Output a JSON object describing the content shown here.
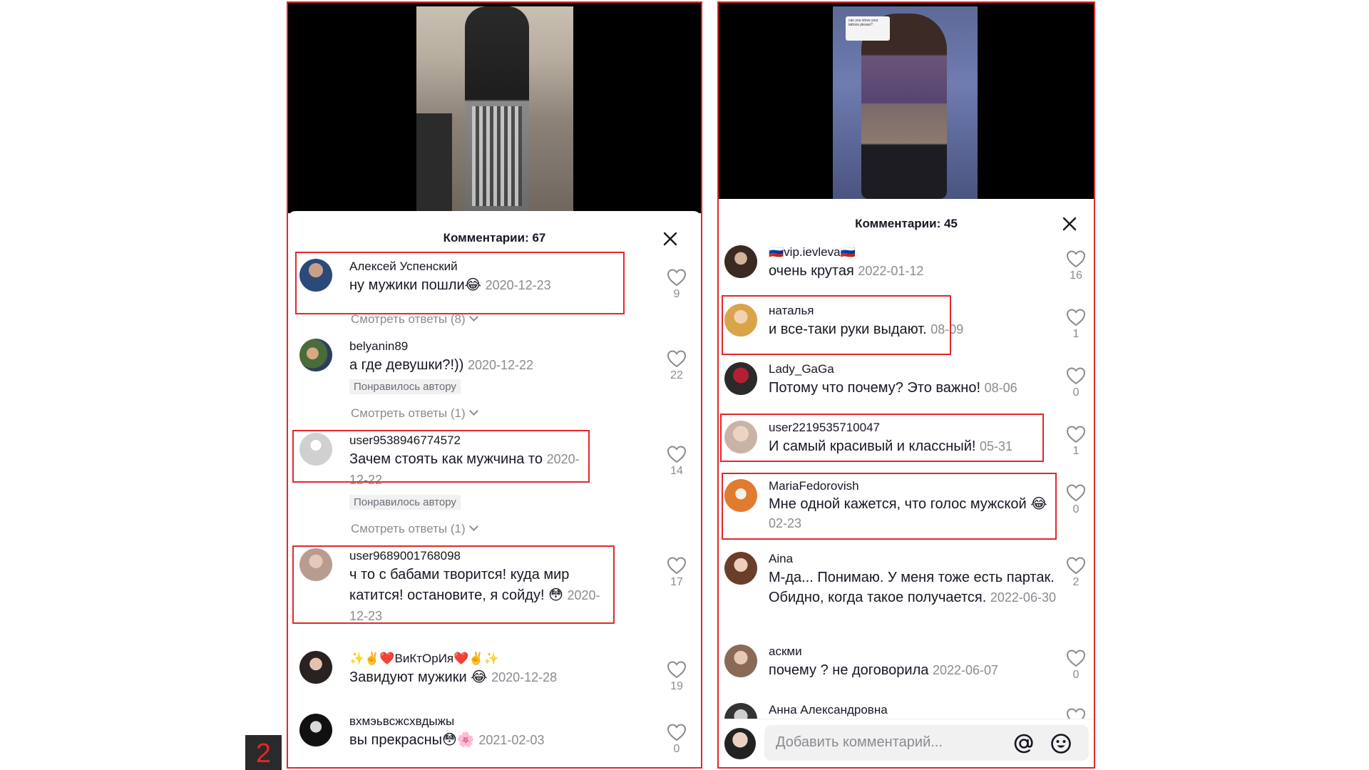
{
  "left": {
    "title": "Комментарии: 67",
    "comments": [
      {
        "user": "Алексей Успенский",
        "text": "ну мужики пошли😂",
        "date": "2020-12-23",
        "likes": "9",
        "replies": "Смотреть ответы (8)"
      },
      {
        "user": "belyanin89",
        "text": "а где девушки?!))",
        "date": "2020-12-22",
        "likes": "22",
        "liked": "Понравилось автору",
        "replies": "Смотреть ответы (1)"
      },
      {
        "user": "user9538946774572",
        "text": "Зачем стоять как мужчина то",
        "date": "2020-12-22",
        "likes": "14",
        "liked": "Понравилось автору",
        "replies": "Смотреть ответы (1)"
      },
      {
        "user": "user9689001768098",
        "text": "ч то с бабами творится! куда мир катится! остановите, я сойду! 😳",
        "date": "2020-12-23",
        "likes": "17"
      },
      {
        "user": "✨✌️❤️ВиКтОрИя❤️✌️✨",
        "text": "Завидуют мужики 😂",
        "date": "2020-12-28",
        "likes": "19"
      },
      {
        "user": "вхмэьвсжсхвдыжы",
        "text": "вы прекрасны😳🌸",
        "date": "2021-02-03",
        "likes": "0"
      }
    ]
  },
  "right": {
    "title": "Комментарии: 45",
    "video_bubble": "can you show your tattoos please?",
    "comments": [
      {
        "user": "🇷🇺vip.ievleva🇷🇺",
        "text": "очень крутая",
        "date": "2022-01-12",
        "likes": "16"
      },
      {
        "user": "наталья",
        "text": "и все-таки руки выдают.",
        "date": "08-09",
        "likes": "1"
      },
      {
        "user": "Lady_GaGa",
        "text": "Потому что почему? Это важно!",
        "date": "08-06",
        "likes": "0"
      },
      {
        "user": "user2219535710047",
        "text": "И самый красивый и классный!",
        "date": "05-31",
        "likes": "1"
      },
      {
        "user": "MariaFedorovish",
        "text": "Мне одной кажется, что голос мужской 😂",
        "date": "02-23",
        "likes": "0"
      },
      {
        "user": "Aina",
        "text": "М-да... Понимаю. У меня тоже есть партак. Обидно, когда такое получается.",
        "date": "2022-06-30",
        "likes": "2"
      },
      {
        "user": "аскми",
        "text": "почему ? не договорила",
        "date": "2022-06-07",
        "likes": "0"
      },
      {
        "user": "Анна Александровна",
        "text": "",
        "date": "",
        "likes": ""
      }
    ],
    "input_placeholder": "Добавить комментарий..."
  },
  "badge": "2",
  "colors": {
    "highlight": "#e2282a",
    "muted": "#8a8b91",
    "text": "#161823"
  },
  "icons": [
    "close-icon",
    "heart-icon",
    "chevron-down-icon",
    "at-icon",
    "emoji-icon"
  ]
}
